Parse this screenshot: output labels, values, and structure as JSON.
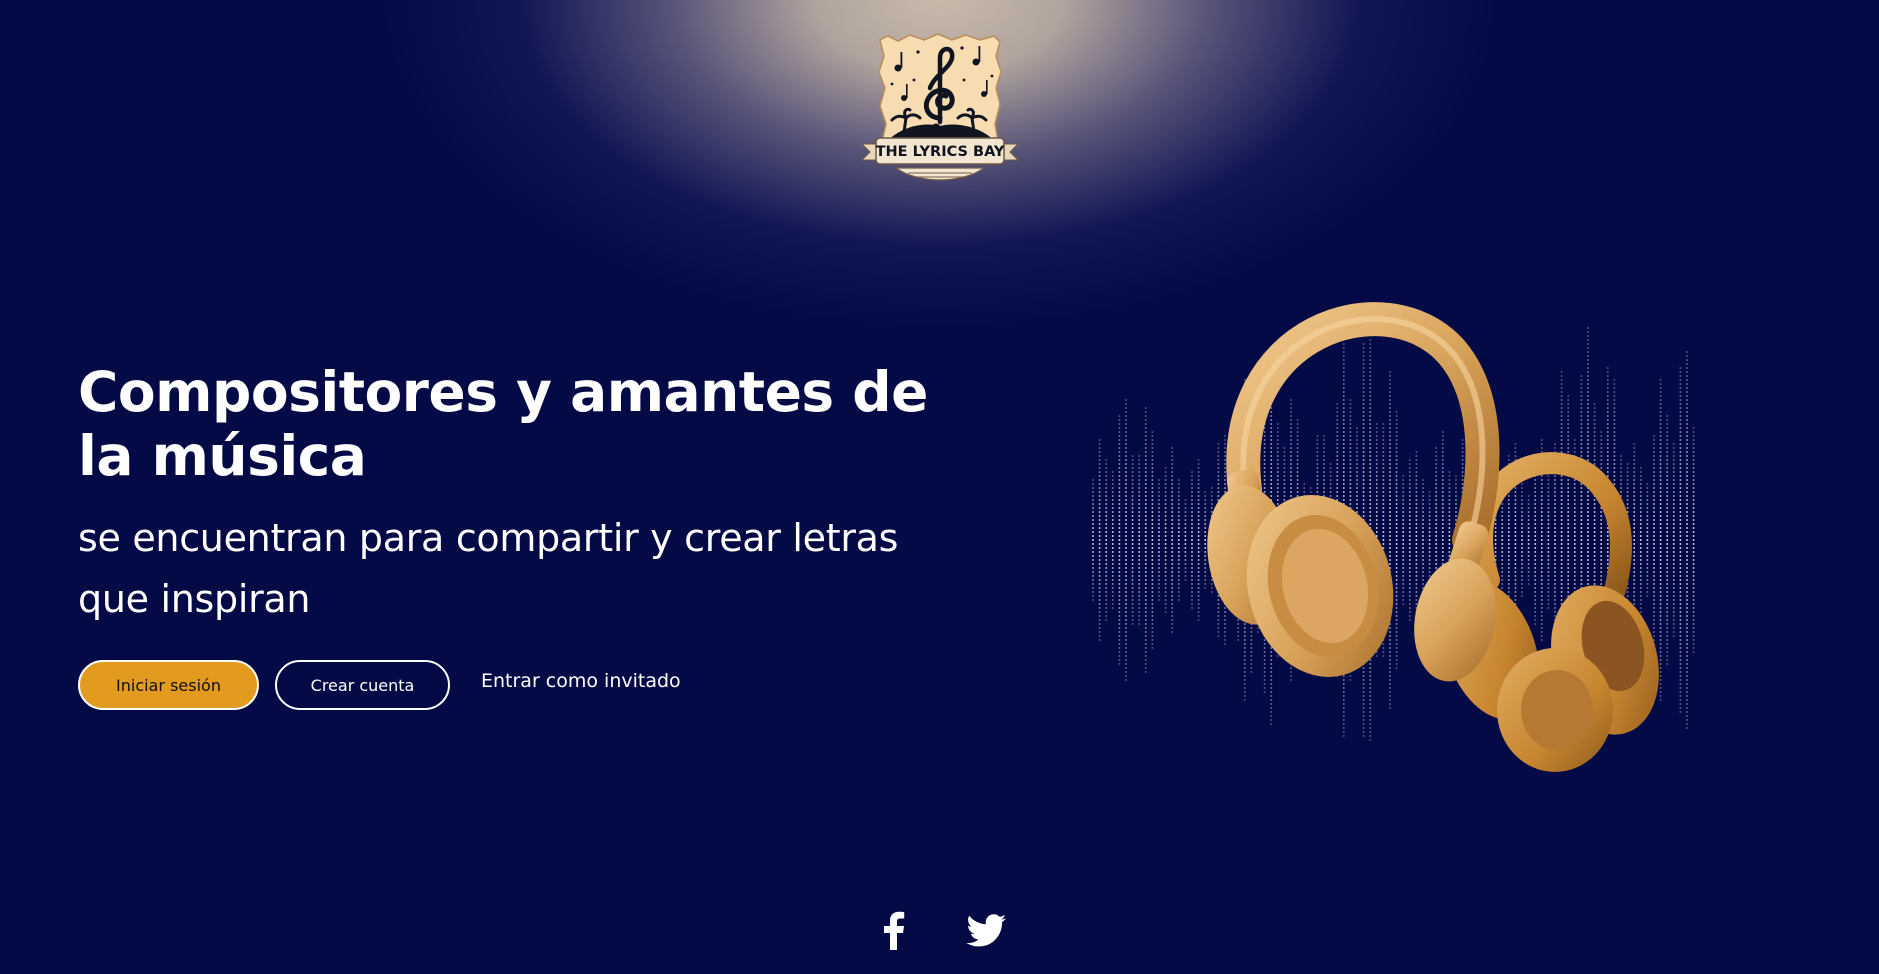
{
  "brand": {
    "logo_text": "THE LYRICS BAY"
  },
  "hero": {
    "title": "Compositores y amantes de la música",
    "subtitle": "se encuentran para compartir y crear letras que inspiran"
  },
  "actions": {
    "login_label": "Iniciar sesión",
    "register_label": "Crear cuenta",
    "guest_label": "Entrar como invitado"
  },
  "social": {
    "icons": [
      "facebook-icon",
      "twitter-icon"
    ]
  },
  "colors": {
    "background": "#040a46",
    "accent": "#e39b1f",
    "text": "#ffffff",
    "headphones": "#d9a45c"
  }
}
